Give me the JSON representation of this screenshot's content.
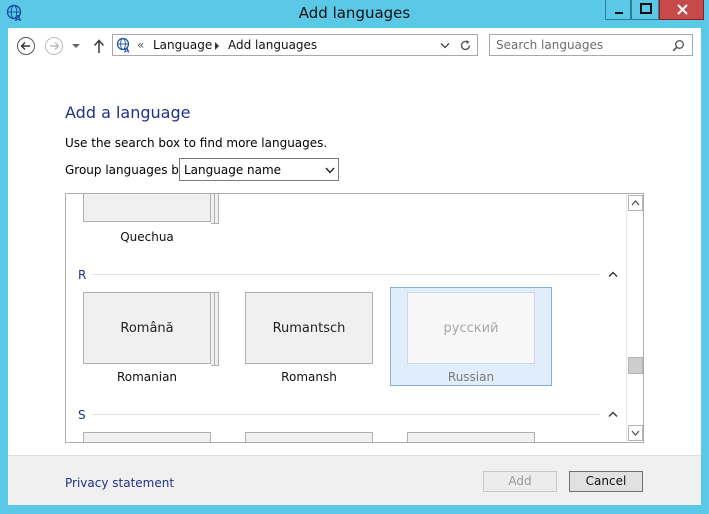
{
  "window": {
    "title": "Add languages",
    "accent": "#5ac8e6"
  },
  "address_bar": {
    "crumb_prefix": "«",
    "crumbs": [
      "Language",
      "Add languages"
    ]
  },
  "search": {
    "placeholder": "Search languages",
    "value": ""
  },
  "page": {
    "heading": "Add a language",
    "hint": "Use the search box to find more languages.",
    "group_label": "Group languages by:",
    "group_by_value": "Language name"
  },
  "list": {
    "partial_top": {
      "english": "Quechua"
    },
    "sections": [
      {
        "letter": "R",
        "items": [
          {
            "native": "Română",
            "english": "Romanian",
            "stacked": true,
            "selected": false
          },
          {
            "native": "Rumantsch",
            "english": "Romansh",
            "stacked": false,
            "selected": false
          },
          {
            "native": "русский",
            "english": "Russian",
            "stacked": false,
            "selected": true
          }
        ]
      },
      {
        "letter": "S",
        "items": []
      }
    ]
  },
  "footer": {
    "privacy_link": "Privacy statement",
    "add_label": "Add",
    "cancel_label": "Cancel"
  }
}
